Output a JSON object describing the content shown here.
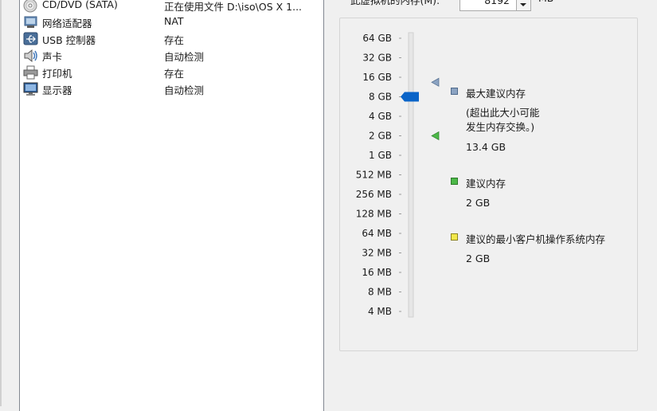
{
  "devices": [
    {
      "name": "CD/DVD (SATA)",
      "value": "正在使用文件 D:\\iso\\OS X 1...",
      "icon": "cd-icon"
    },
    {
      "name": "网络适配器",
      "value": "NAT",
      "icon": "network-adapter-icon"
    },
    {
      "name": "USB 控制器",
      "value": "存在",
      "icon": "usb-icon"
    },
    {
      "name": "声卡",
      "value": "自动检测",
      "icon": "speaker-icon"
    },
    {
      "name": "打印机",
      "value": "存在",
      "icon": "printer-icon"
    },
    {
      "name": "显示器",
      "value": "自动检测",
      "icon": "monitor-icon"
    }
  ],
  "memory": {
    "label": "此虚拟机的内存(M):",
    "value": "8192",
    "unit": "MB"
  },
  "chart_data": {
    "type": "slider-scale",
    "scale": "log2",
    "ticks": [
      "64 GB",
      "32 GB",
      "16 GB",
      "8 GB",
      "4 GB",
      "2 GB",
      "1 GB",
      "512 MB",
      "256 MB",
      "128 MB",
      "64 MB",
      "32 MB",
      "16 MB",
      "8 MB",
      "4 MB"
    ],
    "tick_values_mb": [
      65536,
      32768,
      16384,
      8192,
      4096,
      2048,
      1024,
      512,
      256,
      128,
      64,
      32,
      16,
      8,
      4
    ],
    "current_mb": 8192,
    "max_recommended_mb": 13722,
    "recommended_mb": 2048,
    "min_guest_mb": 2048
  },
  "legend": {
    "max_recommended": {
      "title": "最大建议内存",
      "note1": "(超出此大小可能",
      "note2": "发生内存交换。)",
      "value": "13.4 GB",
      "color": "#8ba3c2"
    },
    "recommended": {
      "title": "建议内存",
      "value": "2 GB",
      "color": "#4cb848"
    },
    "min_guest": {
      "title": "建议的最小客户机操作系统内存",
      "value": "2 GB",
      "color": "#f2e84a"
    }
  },
  "colors": {
    "slider_thumb": "#0a64c8",
    "panel_border": "#828790"
  }
}
